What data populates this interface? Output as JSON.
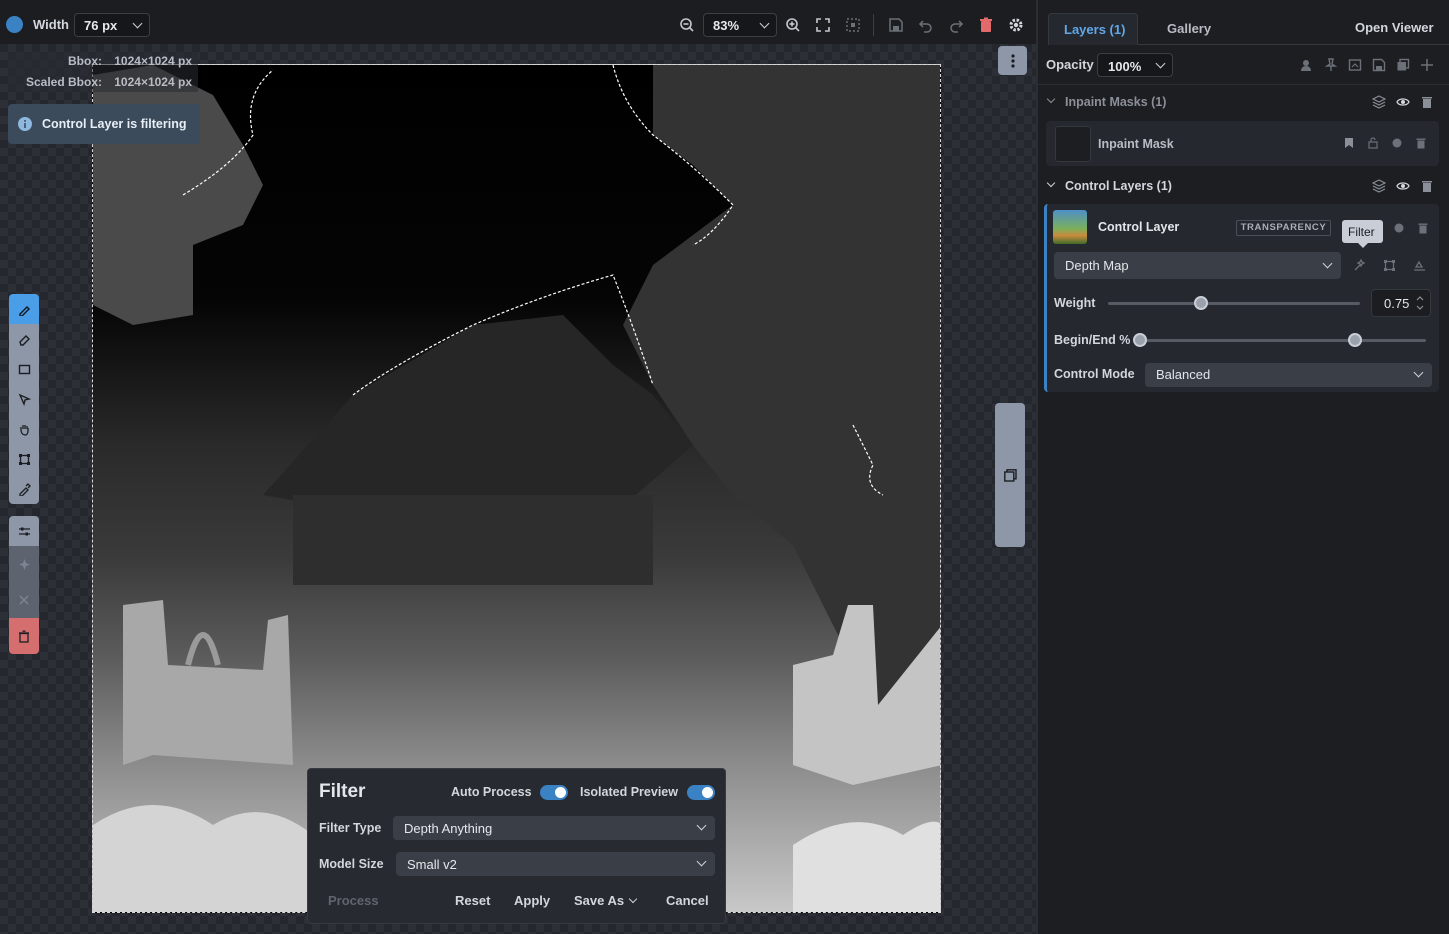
{
  "toolbar": {
    "width_label": "Width",
    "width_value": "76 px",
    "zoom_value": "83%"
  },
  "canvas": {
    "bbox_label": "Bbox:",
    "bbox_value": "1024×1024 px",
    "scaled_bbox_label": "Scaled Bbox:",
    "scaled_bbox_value": "1024×1024 px",
    "notice": "Control Layer is filtering"
  },
  "filter_panel": {
    "title": "Filter",
    "auto_process_label": "Auto Process",
    "auto_process_on": true,
    "isolated_preview_label": "Isolated Preview",
    "isolated_preview_on": true,
    "filter_type_label": "Filter Type",
    "filter_type_value": "Depth Anything",
    "model_size_label": "Model Size",
    "model_size_value": "Small v2",
    "process_label": "Process",
    "reset_label": "Reset",
    "apply_label": "Apply",
    "save_as_label": "Save As",
    "cancel_label": "Cancel"
  },
  "right_panel": {
    "tabs": [
      {
        "label": "Layers (1)",
        "active": true
      },
      {
        "label": "Gallery",
        "active": false
      }
    ],
    "open_viewer_label": "Open Viewer",
    "opacity_label": "Opacity",
    "opacity_value": "100%",
    "inpaint_section": {
      "title": "Inpaint Masks (1)",
      "layer_name": "Inpaint Mask"
    },
    "control_section": {
      "title": "Control Layers (1)",
      "layer_name": "Control Layer",
      "badge": "TRANSPARENCY",
      "tooltip": "Filter",
      "model_value": "Depth Map",
      "weight_label": "Weight",
      "weight_value": "0.75",
      "weight_fraction": 0.37,
      "begin_end_label": "Begin/End %",
      "begin_fraction": 0.0,
      "end_fraction": 0.75,
      "control_mode_label": "Control Mode",
      "control_mode_value": "Balanced"
    }
  },
  "colors": {
    "accent": "#3b82c4",
    "tab_active": "#62a8e8",
    "danger": "#e26a6a"
  }
}
